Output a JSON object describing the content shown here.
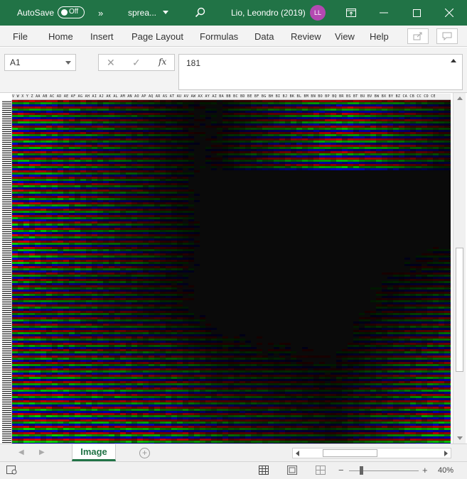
{
  "titlebar": {
    "autosave_label": "AutoSave",
    "autosave_state": "Off",
    "overflow_label": "»",
    "filename": "sprea...",
    "user_name": "Lio, Leondro (2019)",
    "user_initials": "LL"
  },
  "ribbon": {
    "tabs": [
      "File",
      "Home",
      "Insert",
      "Page Layout",
      "Formulas",
      "Data",
      "Review",
      "View",
      "Help"
    ]
  },
  "formula_bar": {
    "name_box": "A1",
    "cancel_glyph": "✕",
    "enter_glyph": "✓",
    "fx_glyph": "fx",
    "value": "181"
  },
  "grid": {
    "column_headers": "V W X Y Z AA AB AC AD AE AF AG AH AI AJ AK AL AM AN AO AP AQ AR AS AT AU AV AW AX AY AZ BA BB BC BD BE BF BG BH BI BJ BK BL BM BN BO BP BQ BR BS BT BU BV BW BX BY BZ CA CB CC CD CE"
  },
  "sheets": {
    "tabs": [
      "Image"
    ],
    "active": "Image"
  },
  "statusbar": {
    "zoom_minus": "−",
    "zoom_plus": "+",
    "zoom": "40%"
  },
  "colors": {
    "brand": "#217346",
    "avatar": "#b349b1"
  }
}
